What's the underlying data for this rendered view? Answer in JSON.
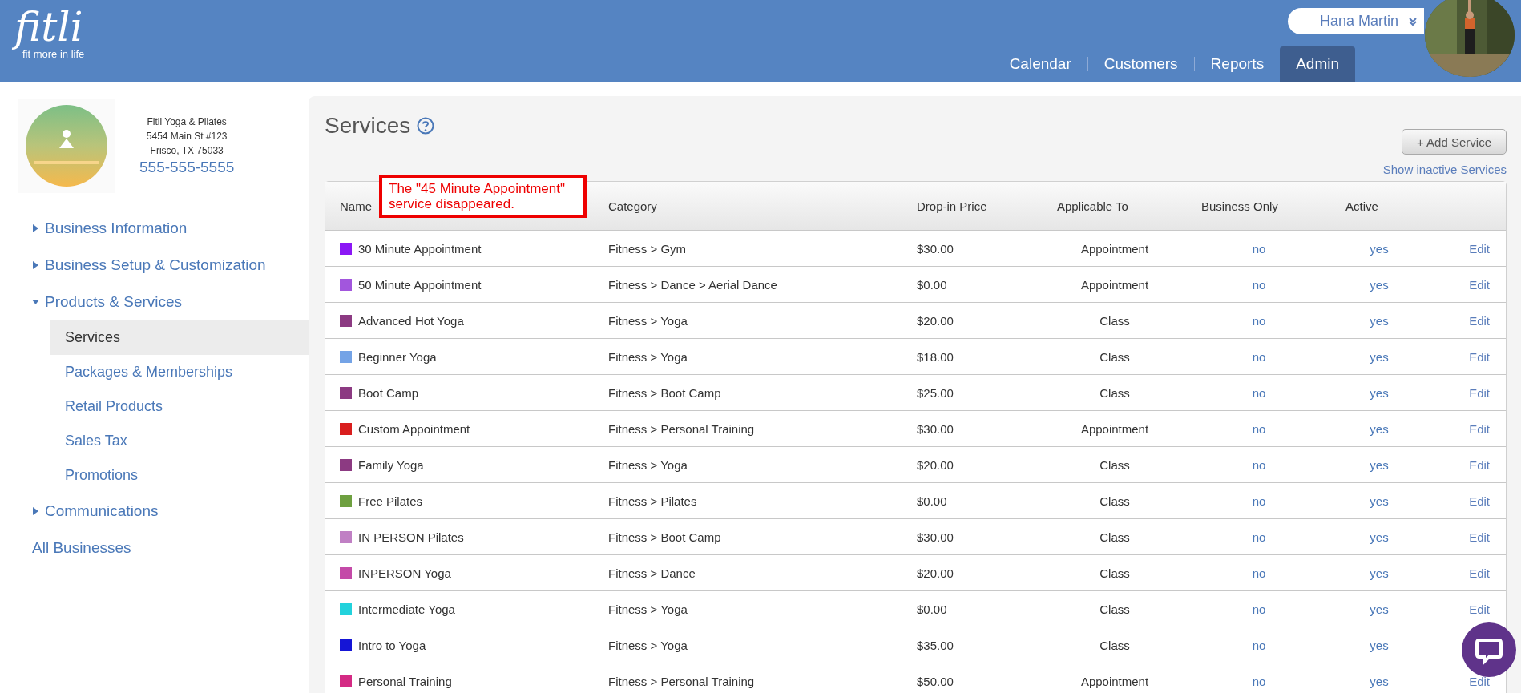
{
  "header": {
    "logo": {
      "wordmark": "fitli",
      "tagline": "fit more in life"
    },
    "user": {
      "name": "Hana Martin"
    },
    "nav": [
      {
        "label": "Calendar",
        "selected": false
      },
      {
        "label": "Customers",
        "selected": false
      },
      {
        "label": "Reports",
        "selected": false
      },
      {
        "label": "Admin",
        "selected": true
      }
    ]
  },
  "sidebar": {
    "business": {
      "name": "Fitli Yoga & Pilates",
      "address_line_1": "5454 Main St #123",
      "address_line_2": "Frisco, TX 75033",
      "phone": "555-555-5555"
    },
    "items": [
      {
        "label": "Business Information",
        "expanded": false,
        "kind": "group"
      },
      {
        "label": "Business Setup & Customization",
        "expanded": false,
        "kind": "group"
      },
      {
        "label": "Products & Services",
        "expanded": true,
        "kind": "group",
        "children": [
          {
            "label": "Services",
            "selected": true
          },
          {
            "label": "Packages & Memberships",
            "selected": false
          },
          {
            "label": "Retail Products",
            "selected": false
          },
          {
            "label": "Sales Tax",
            "selected": false
          },
          {
            "label": "Promotions",
            "selected": false
          }
        ]
      },
      {
        "label": "Communications",
        "expanded": false,
        "kind": "group"
      },
      {
        "label": "All Businesses",
        "kind": "link"
      }
    ]
  },
  "main": {
    "title": "Services",
    "add_button": "+ Add Service",
    "show_inactive_link": "Show inactive Services",
    "annotation": "The \"45 Minute Appointment\" service disappeared.",
    "table": {
      "columns": [
        "Name",
        "Category",
        "Drop-in Price",
        "Applicable To",
        "Business Only",
        "Active"
      ],
      "rows": [
        {
          "name": "30 Minute Appointment",
          "color": "#8b17f5",
          "category": "Fitness > Gym",
          "price": "$30.00",
          "applicable_to": "Appointment",
          "business_only": "no",
          "active": "yes",
          "action": "Edit"
        },
        {
          "name": "50 Minute Appointment",
          "color": "#a256dd",
          "category": "Fitness > Dance > Aerial Dance",
          "price": "$0.00",
          "applicable_to": "Appointment",
          "business_only": "no",
          "active": "yes",
          "action": "Edit"
        },
        {
          "name": "Advanced Hot Yoga",
          "color": "#8c3a82",
          "category": "Fitness > Yoga",
          "price": "$20.00",
          "applicable_to": "Class",
          "business_only": "no",
          "active": "yes",
          "action": "Edit"
        },
        {
          "name": "Beginner Yoga",
          "color": "#74a3e6",
          "category": "Fitness > Yoga",
          "price": "$18.00",
          "applicable_to": "Class",
          "business_only": "no",
          "active": "yes",
          "action": "Edit"
        },
        {
          "name": "Boot Camp",
          "color": "#8c3a82",
          "category": "Fitness > Boot Camp",
          "price": "$25.00",
          "applicable_to": "Class",
          "business_only": "no",
          "active": "yes",
          "action": "Edit"
        },
        {
          "name": "Custom Appointment",
          "color": "#d91e1e",
          "category": "Fitness > Personal Training",
          "price": "$30.00",
          "applicable_to": "Appointment",
          "business_only": "no",
          "active": "yes",
          "action": "Edit"
        },
        {
          "name": "Family Yoga",
          "color": "#8c3a82",
          "category": "Fitness > Yoga",
          "price": "$20.00",
          "applicable_to": "Class",
          "business_only": "no",
          "active": "yes",
          "action": "Edit"
        },
        {
          "name": "Free Pilates",
          "color": "#6ea040",
          "category": "Fitness > Pilates",
          "price": "$0.00",
          "applicable_to": "Class",
          "business_only": "no",
          "active": "yes",
          "action": "Edit"
        },
        {
          "name": "IN PERSON Pilates",
          "color": "#c080c4",
          "category": "Fitness > Boot Camp",
          "price": "$30.00",
          "applicable_to": "Class",
          "business_only": "no",
          "active": "yes",
          "action": "Edit"
        },
        {
          "name": "INPERSON Yoga",
          "color": "#c44aa8",
          "category": "Fitness > Dance",
          "price": "$20.00",
          "applicable_to": "Class",
          "business_only": "no",
          "active": "yes",
          "action": "Edit"
        },
        {
          "name": "Intermediate Yoga",
          "color": "#22d2dc",
          "category": "Fitness > Yoga",
          "price": "$0.00",
          "applicable_to": "Class",
          "business_only": "no",
          "active": "yes",
          "action": "Edit"
        },
        {
          "name": "Intro to Yoga",
          "color": "#1515d6",
          "category": "Fitness > Yoga",
          "price": "$35.00",
          "applicable_to": "Class",
          "business_only": "no",
          "active": "yes"
        },
        {
          "name": "Personal Training",
          "color": "#d42a84",
          "category": "Fitness > Personal Training",
          "price": "$50.00",
          "applicable_to": "Appointment",
          "business_only": "no",
          "active": "yes",
          "action": "Edit"
        }
      ]
    }
  },
  "chat_button": {
    "kind": "chat"
  }
}
